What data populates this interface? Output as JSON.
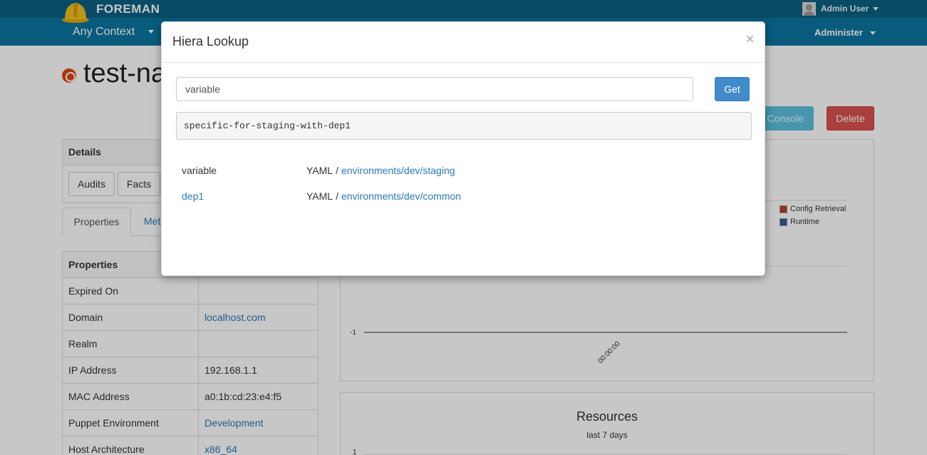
{
  "topbar": {
    "brand": "FOREMAN",
    "user": "Admin User",
    "context": "Any Context",
    "administer": "Administer"
  },
  "host": {
    "name": "test-na"
  },
  "actions": {
    "console": "Console",
    "delete": "Delete"
  },
  "details": {
    "heading": "Details",
    "buttons": [
      "Audits",
      "Facts"
    ]
  },
  "tabs": {
    "properties": "Properties",
    "metrics": "Met"
  },
  "properties": {
    "heading": "Properties",
    "rows": [
      {
        "key": "Expired On",
        "value": ""
      },
      {
        "key": "Domain",
        "value": "localhost.com"
      },
      {
        "key": "Realm",
        "value": ""
      },
      {
        "key": "IP Address",
        "value": "192.168.1.1"
      },
      {
        "key": "MAC Address",
        "value": "a0:1b:cd:23:e4:f5"
      },
      {
        "key": "Puppet Environment",
        "value": "Development"
      },
      {
        "key": "Host Architecture",
        "value": "x86_64"
      }
    ]
  },
  "chart": {
    "legend": [
      {
        "label": "Config Retrieval",
        "color": "#c0392b"
      },
      {
        "label": "Runtime",
        "color": "#2c5aa0"
      }
    ],
    "y_tick": "-1",
    "x_tick": "00:00:00"
  },
  "resources": {
    "title": "Resources",
    "subtitle": "last 7 days",
    "y_tick": "1"
  },
  "modal": {
    "title": "Hiera Lookup",
    "close": "×",
    "input_value": "variable",
    "get_label": "Get",
    "result": "specific-for-staging-with-dep1",
    "rows": [
      {
        "name": "variable",
        "type": "YAML",
        "sep": "/",
        "path": "environments/dev/staging"
      },
      {
        "name": "dep1",
        "type": "YAML",
        "sep": "/",
        "path": "environments/dev/common"
      }
    ]
  },
  "colors": {
    "topbar": "#0a6182",
    "navbar": "#0b75a0",
    "primary": "#428bca",
    "danger": "#d9534f",
    "link": "#2a7ab8"
  }
}
